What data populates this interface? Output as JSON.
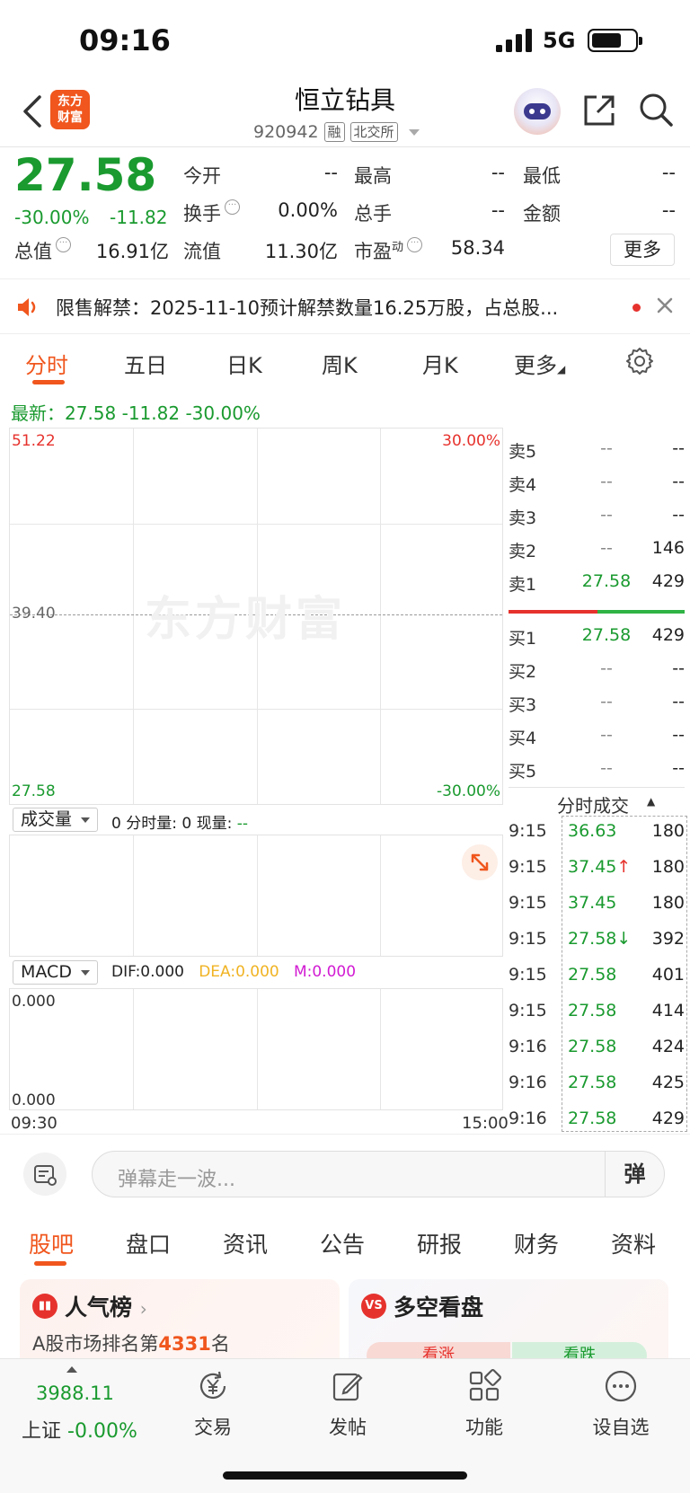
{
  "status_bar": {
    "time": "09:16",
    "network": "5G"
  },
  "header": {
    "logo_text": "东方财富",
    "stock_name": "恒立钻具",
    "stock_code": "920942",
    "tag_margin": "融",
    "tag_exchange": "北交所"
  },
  "quote": {
    "price": "27.58",
    "change_pct": "-30.00%",
    "change_amt": "-11.82",
    "fields": {
      "open_label": "今开",
      "open_value": "--",
      "high_label": "最高",
      "high_value": "--",
      "low_label": "最低",
      "low_value": "--",
      "turnover_label": "换手",
      "turnover_value": "0.00%",
      "volume_label": "总手",
      "volume_value": "--",
      "amount_label": "金额",
      "amount_value": "--",
      "mktcap_label": "总值",
      "mktcap_value": "16.91亿",
      "float_label": "流值",
      "float_value": "11.30亿",
      "pe_label": "市盈",
      "pe_sup": "动",
      "pe_value": "58.34"
    },
    "more_button": "更多"
  },
  "notice": {
    "text": "限售解禁：2025-11-10预计解禁数量16.25万股，占总股..."
  },
  "chart_tabs": [
    "分时",
    "五日",
    "日K",
    "周K",
    "月K",
    "更多"
  ],
  "latest_line": "最新：27.58  -11.82  -30.00%",
  "chart": {
    "y_top": "51.22",
    "y_mid": "39.40",
    "y_bottom": "27.58",
    "pct_top": "30.00%",
    "pct_bottom": "-30.00%",
    "watermark": "东方财富",
    "time_start": "09:30",
    "time_end": "15:00"
  },
  "volume_panel": {
    "selector": "成交量",
    "info_prefix": "0 分时量: 0 现量: ",
    "info_value": "--"
  },
  "macd_panel": {
    "selector": "MACD",
    "dif": "DIF:0.000",
    "dea": "DEA:0.000",
    "m": "M:0.000",
    "top_value": "0.000",
    "bottom_value": "0.000"
  },
  "order_book": {
    "asks": [
      {
        "label": "卖5",
        "price": "--",
        "vol": "--"
      },
      {
        "label": "卖4",
        "price": "--",
        "vol": "--"
      },
      {
        "label": "卖3",
        "price": "--",
        "vol": "--"
      },
      {
        "label": "卖2",
        "price": "--",
        "vol": "146"
      },
      {
        "label": "卖1",
        "price": "27.58",
        "vol": "429"
      }
    ],
    "bids": [
      {
        "label": "买1",
        "price": "27.58",
        "vol": "429"
      },
      {
        "label": "买2",
        "price": "--",
        "vol": "--"
      },
      {
        "label": "买3",
        "price": "--",
        "vol": "--"
      },
      {
        "label": "买4",
        "price": "--",
        "vol": "--"
      },
      {
        "label": "买5",
        "price": "--",
        "vol": "--"
      }
    ]
  },
  "ticks": {
    "title": "分时成交",
    "rows": [
      {
        "time": "9:15",
        "price": "36.63",
        "vol": "180"
      },
      {
        "time": "9:15",
        "price": "37.45↑",
        "vol": "180"
      },
      {
        "time": "9:15",
        "price": "37.45",
        "vol": "180"
      },
      {
        "time": "9:15",
        "price": "27.58↓",
        "vol": "392"
      },
      {
        "time": "9:15",
        "price": "27.58",
        "vol": "401"
      },
      {
        "time": "9:15",
        "price": "27.58",
        "vol": "414"
      },
      {
        "time": "9:16",
        "price": "27.58",
        "vol": "424"
      },
      {
        "time": "9:16",
        "price": "27.58",
        "vol": "425"
      },
      {
        "time": "9:16",
        "price": "27.58",
        "vol": "429"
      }
    ]
  },
  "danmu": {
    "placeholder": "弹幕走一波...",
    "send_label": "弹"
  },
  "info_tabs": [
    "股吧",
    "盘口",
    "资讯",
    "公告",
    "研报",
    "财务",
    "资料"
  ],
  "cards": {
    "hot_title": "人气榜",
    "hot_sub_prefix": "A股市场排名第",
    "hot_rank": "4331",
    "hot_sub_suffix": "名",
    "vs_title": "多空看盘",
    "vs_up": "看涨",
    "vs_down": "看跌"
  },
  "bottom_nav": {
    "index_value": "3988.11",
    "index_name": "上证",
    "index_change": "-0.00%",
    "items": [
      "交易",
      "发帖",
      "功能",
      "设自选"
    ]
  },
  "colors": {
    "accent": "#f0561d",
    "down": "#1a9a2f",
    "up": "#e6322d"
  }
}
